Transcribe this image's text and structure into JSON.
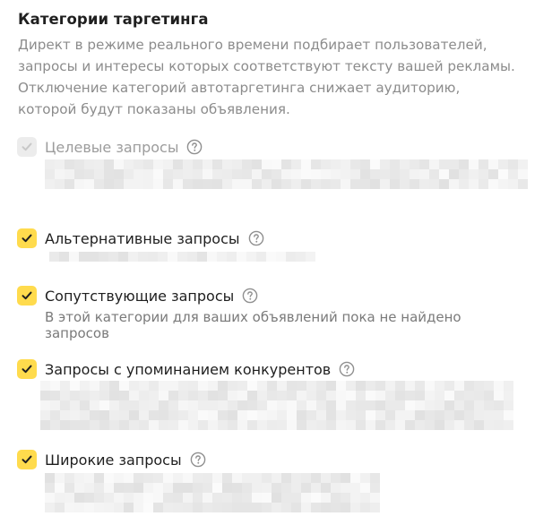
{
  "section": {
    "title": "Категории таргетинга",
    "description": "Директ в режиме реального времени подбирает пользователей, запросы и интересы которых соответствуют тексту вашей рекламы. Отключение категорий автотаргетинга снижает аудиторию, которой будут показаны объявления."
  },
  "categories": [
    {
      "label": "Целевые запросы",
      "checked": true,
      "disabled": true
    },
    {
      "label": "Альтернативные запросы",
      "checked": true,
      "disabled": false
    },
    {
      "label": "Сопутствующие запросы",
      "checked": true,
      "disabled": false,
      "note": "В этой категории для ваших объявлений пока не найдено запросов"
    },
    {
      "label": "Запросы с упоминанием конкурентов",
      "checked": true,
      "disabled": false
    },
    {
      "label": "Широкие запросы",
      "checked": true,
      "disabled": false
    }
  ],
  "icons": {
    "checkbox": "check-icon",
    "help": "question-circle-icon"
  },
  "colors": {
    "checkbox_checked": "#ffdb4d",
    "checkbox_disabled": "#ececec",
    "text_muted": "#8c8c8c"
  }
}
